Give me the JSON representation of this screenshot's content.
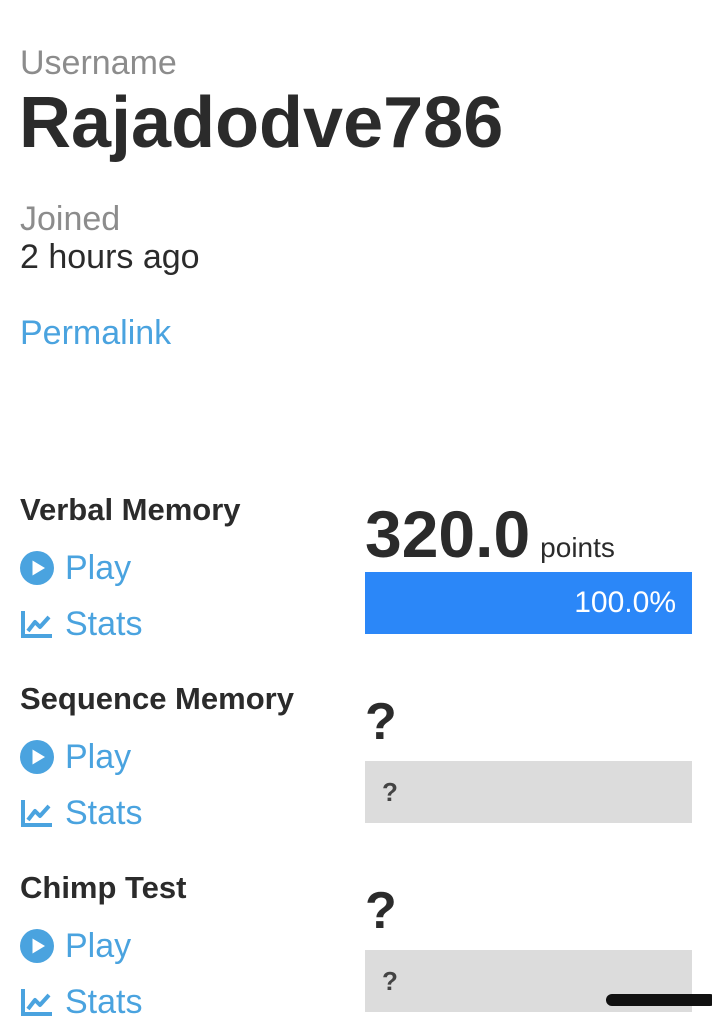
{
  "profile": {
    "username_label": "Username",
    "username": "Rajadodve786",
    "joined_label": "Joined",
    "joined_value": "2 hours ago",
    "permalink_label": "Permalink"
  },
  "colors": {
    "link": "#4aa3df",
    "bar_fill": "#2b87f8",
    "bar_empty": "#dcdcdc",
    "text": "#2b2b2b",
    "muted": "#8c8c8c"
  },
  "tests": [
    {
      "name": "Verbal Memory",
      "play_label": "Play",
      "stats_label": "Stats",
      "play_icon": "play-circle-icon",
      "stats_icon": "line-chart-icon",
      "score": "320.0",
      "score_unit": "points",
      "percentile_label": "100.0%",
      "percentile": 1.0
    },
    {
      "name": "Sequence Memory",
      "play_label": "Play",
      "stats_label": "Stats",
      "play_icon": "play-circle-icon",
      "stats_icon": "line-chart-icon",
      "score": "?",
      "percentile_label": "?"
    },
    {
      "name": "Chimp Test",
      "play_label": "Play",
      "stats_label": "Stats",
      "play_icon": "play-circle-icon",
      "stats_icon": "line-chart-icon",
      "score": "?",
      "percentile_label": "?"
    }
  ]
}
